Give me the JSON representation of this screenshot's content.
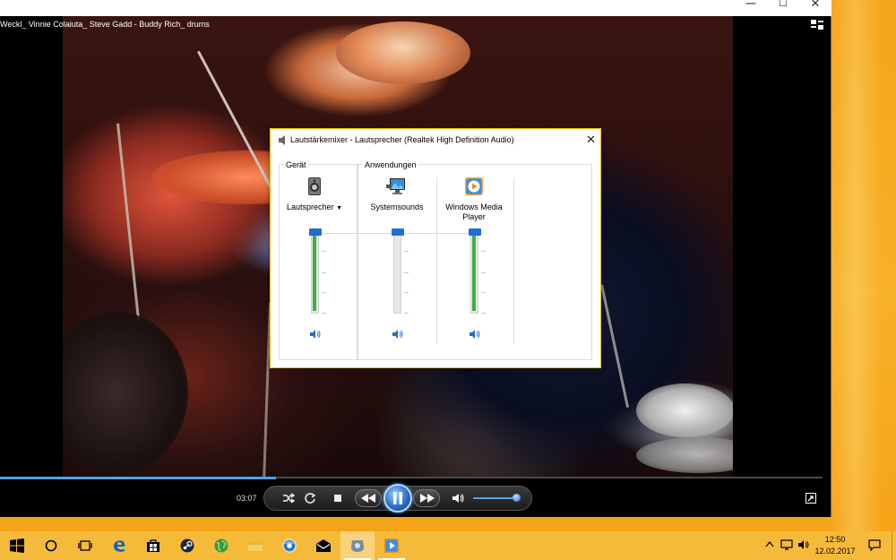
{
  "player": {
    "movie_title": "Weckl_ Vinnie Colaiuta_ Steve Gadd - Buddy Rich_ drums",
    "window_controls": [
      "minimize",
      "maximize",
      "close"
    ],
    "time_elapsed": "03:07",
    "seek_progress": 0.335,
    "volume_level": 0.95,
    "accent_color": "#1e6fd0",
    "controls": [
      "shuffle-icon",
      "repeat-icon",
      "stop-icon",
      "previous-icon",
      "pause-icon",
      "next-icon",
      "volume-icon",
      "fullscreen-icon"
    ]
  },
  "mixer": {
    "title": "Lautstärkemixer - Lautsprecher (Realtek High Definition Audio)",
    "device_group_label": "Gerät",
    "apps_group_label": "Anwendungen",
    "channels": [
      {
        "label": "Lautsprecher",
        "has_dropdown": true,
        "level": 1.0,
        "icon": "speaker-device-icon"
      },
      {
        "label": "Systemsounds",
        "level": 1.0,
        "icon": "system-sounds-icon"
      },
      {
        "label": "Windows Media Player",
        "level": 1.0,
        "icon": "media-player-icon"
      }
    ],
    "slider_fill_color": "#3cb043"
  },
  "taskbar": {
    "pinned": [
      "start-icon",
      "cortana-icon",
      "task-view-icon",
      "edge-icon",
      "store-icon",
      "steam-icon",
      "globe-icon",
      "file-explorer-icon",
      "chrome-icon",
      "mail-icon",
      "volume-mixer-icon",
      "media-player-icon"
    ],
    "time": "12:50",
    "date": "12.02.2017",
    "color": "#f6ba3a"
  }
}
